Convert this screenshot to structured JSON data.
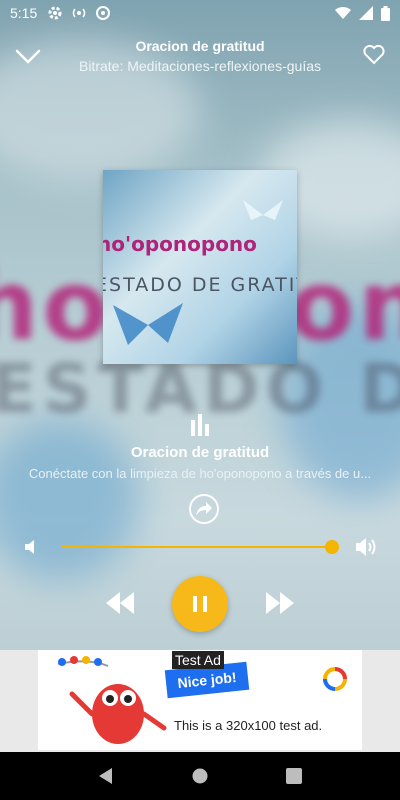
{
  "status_bar": {
    "time": "5:15"
  },
  "header": {
    "title": "Oracion de gratitud",
    "subtitle": "Bitrate: Meditaciones-reflexiones-guías"
  },
  "artwork": {
    "line1": "ho'oponopono",
    "line2": "ESTADO DE GRATITUD"
  },
  "track": {
    "title": "Oracion de gratitud",
    "description": "Conéctate con la limpieza de ho'oponopono a través de u..."
  },
  "volume": {
    "level": 0.98
  },
  "player": {
    "state": "playing"
  },
  "ad": {
    "label": "Test Ad",
    "badge": "Nice job!",
    "text": "This is a 320x100 test ad."
  },
  "colors": {
    "accent": "#f7b819",
    "artwork_pink": "#b0237a"
  },
  "icons": [
    "chevron-down-icon",
    "heart-icon",
    "equalizer-icon",
    "share-icon",
    "volume-low-icon",
    "volume-high-icon",
    "rewind-icon",
    "pause-icon",
    "fast-forward-icon",
    "back-icon",
    "home-icon",
    "recents-icon"
  ]
}
